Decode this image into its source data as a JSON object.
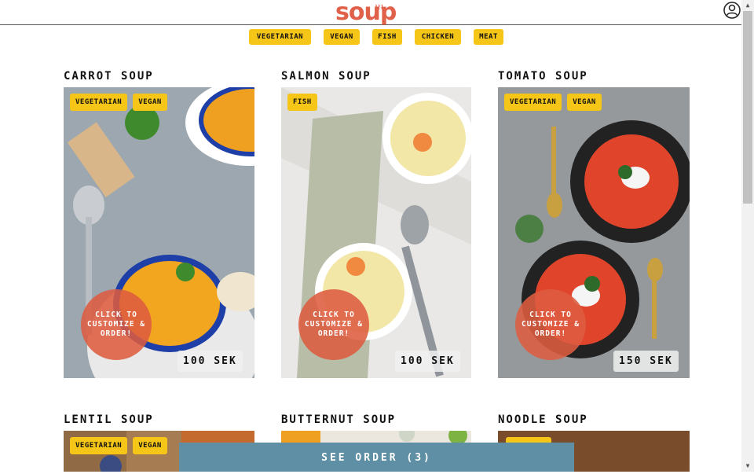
{
  "header": {
    "logo_text": "soup",
    "logo_color": "#e0604a"
  },
  "filters": [
    {
      "label": "VEGETARIAN"
    },
    {
      "label": "VEGAN"
    },
    {
      "label": "FISH"
    },
    {
      "label": "CHICKEN"
    },
    {
      "label": "MEAT"
    }
  ],
  "cards": [
    {
      "title": "CARROT SOUP",
      "tags": [
        "VEGETARIAN",
        "VEGAN"
      ],
      "cta": "CLICK TO CUSTOMIZE & ORDER!",
      "price": "100 SEK"
    },
    {
      "title": "SALMON SOUP",
      "tags": [
        "FISH"
      ],
      "cta": "CLICK TO CUSTOMIZE & ORDER!",
      "price": "100 SEK"
    },
    {
      "title": "TOMATO SOUP",
      "tags": [
        "VEGETARIAN",
        "VEGAN"
      ],
      "cta": "CLICK TO CUSTOMIZE & ORDER!",
      "price": "150 SEK"
    },
    {
      "title": "LENTIL SOUP",
      "tags": [
        "VEGETARIAN",
        "VEGAN"
      ]
    },
    {
      "title": "BUTTERNUT SOUP",
      "tags": []
    },
    {
      "title": "NOODLE SOUP",
      "tags": []
    }
  ],
  "order_bar": {
    "label": "SEE ORDER (3)"
  },
  "colors": {
    "accent_yellow": "#f5c518",
    "cta_red": "#dd5c40",
    "order_bar": "#5e8fa4"
  }
}
